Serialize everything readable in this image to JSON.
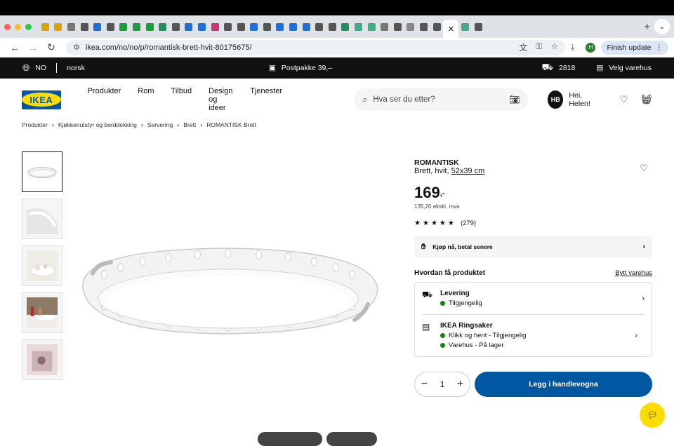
{
  "browser": {
    "url": "ikea.com/no/no/p/romantisk-brett-hvit-80175675/",
    "finish_update": "Finish update",
    "profile_letter": "H"
  },
  "topbar": {
    "country": "NO",
    "language": "norsk",
    "shipping": "Postpakke 39,–",
    "zip": "2818",
    "store": "Velg varehus"
  },
  "nav": {
    "logo": "IKEA",
    "links": [
      "Produkter",
      "Rom",
      "Tilbud",
      "Design og ideer",
      "Tjenester"
    ],
    "search_placeholder": "Hva ser du etter?",
    "avatar": "HB",
    "greeting": "Hei, Helen!"
  },
  "breadcrumb": [
    "Produkter",
    "Kjøkkenutstyr og borddekking",
    "Servering",
    "Brett",
    "ROMANTISK Brett"
  ],
  "product": {
    "name": "ROMANTISK",
    "desc_prefix": "Brett, hvit, ",
    "size": "52x39 cm",
    "price": "169",
    "price_suffix": ",-",
    "ex_vat": "135,20 ekskl. mva",
    "rating_count": "(279)",
    "stars": 5
  },
  "klarna": "Kjøp nå, betal senere",
  "how_to_get": {
    "title": "Hvordan få produktet",
    "change_store": "Bytt varehus",
    "delivery": {
      "title": "Levering",
      "status": "Tilgjengelig"
    },
    "store": {
      "title": "IKEA Ringsaker",
      "click_collect": "Klikk og hent - Tilgjengelig",
      "instore": "Varehus - På lager"
    }
  },
  "cart": {
    "quantity": "1",
    "add_label": "Legg i handlevogna"
  },
  "colors": {
    "ikea_blue": "#0058a3",
    "ikea_yellow": "#ffdb00",
    "in_stock": "#0a8a00"
  }
}
